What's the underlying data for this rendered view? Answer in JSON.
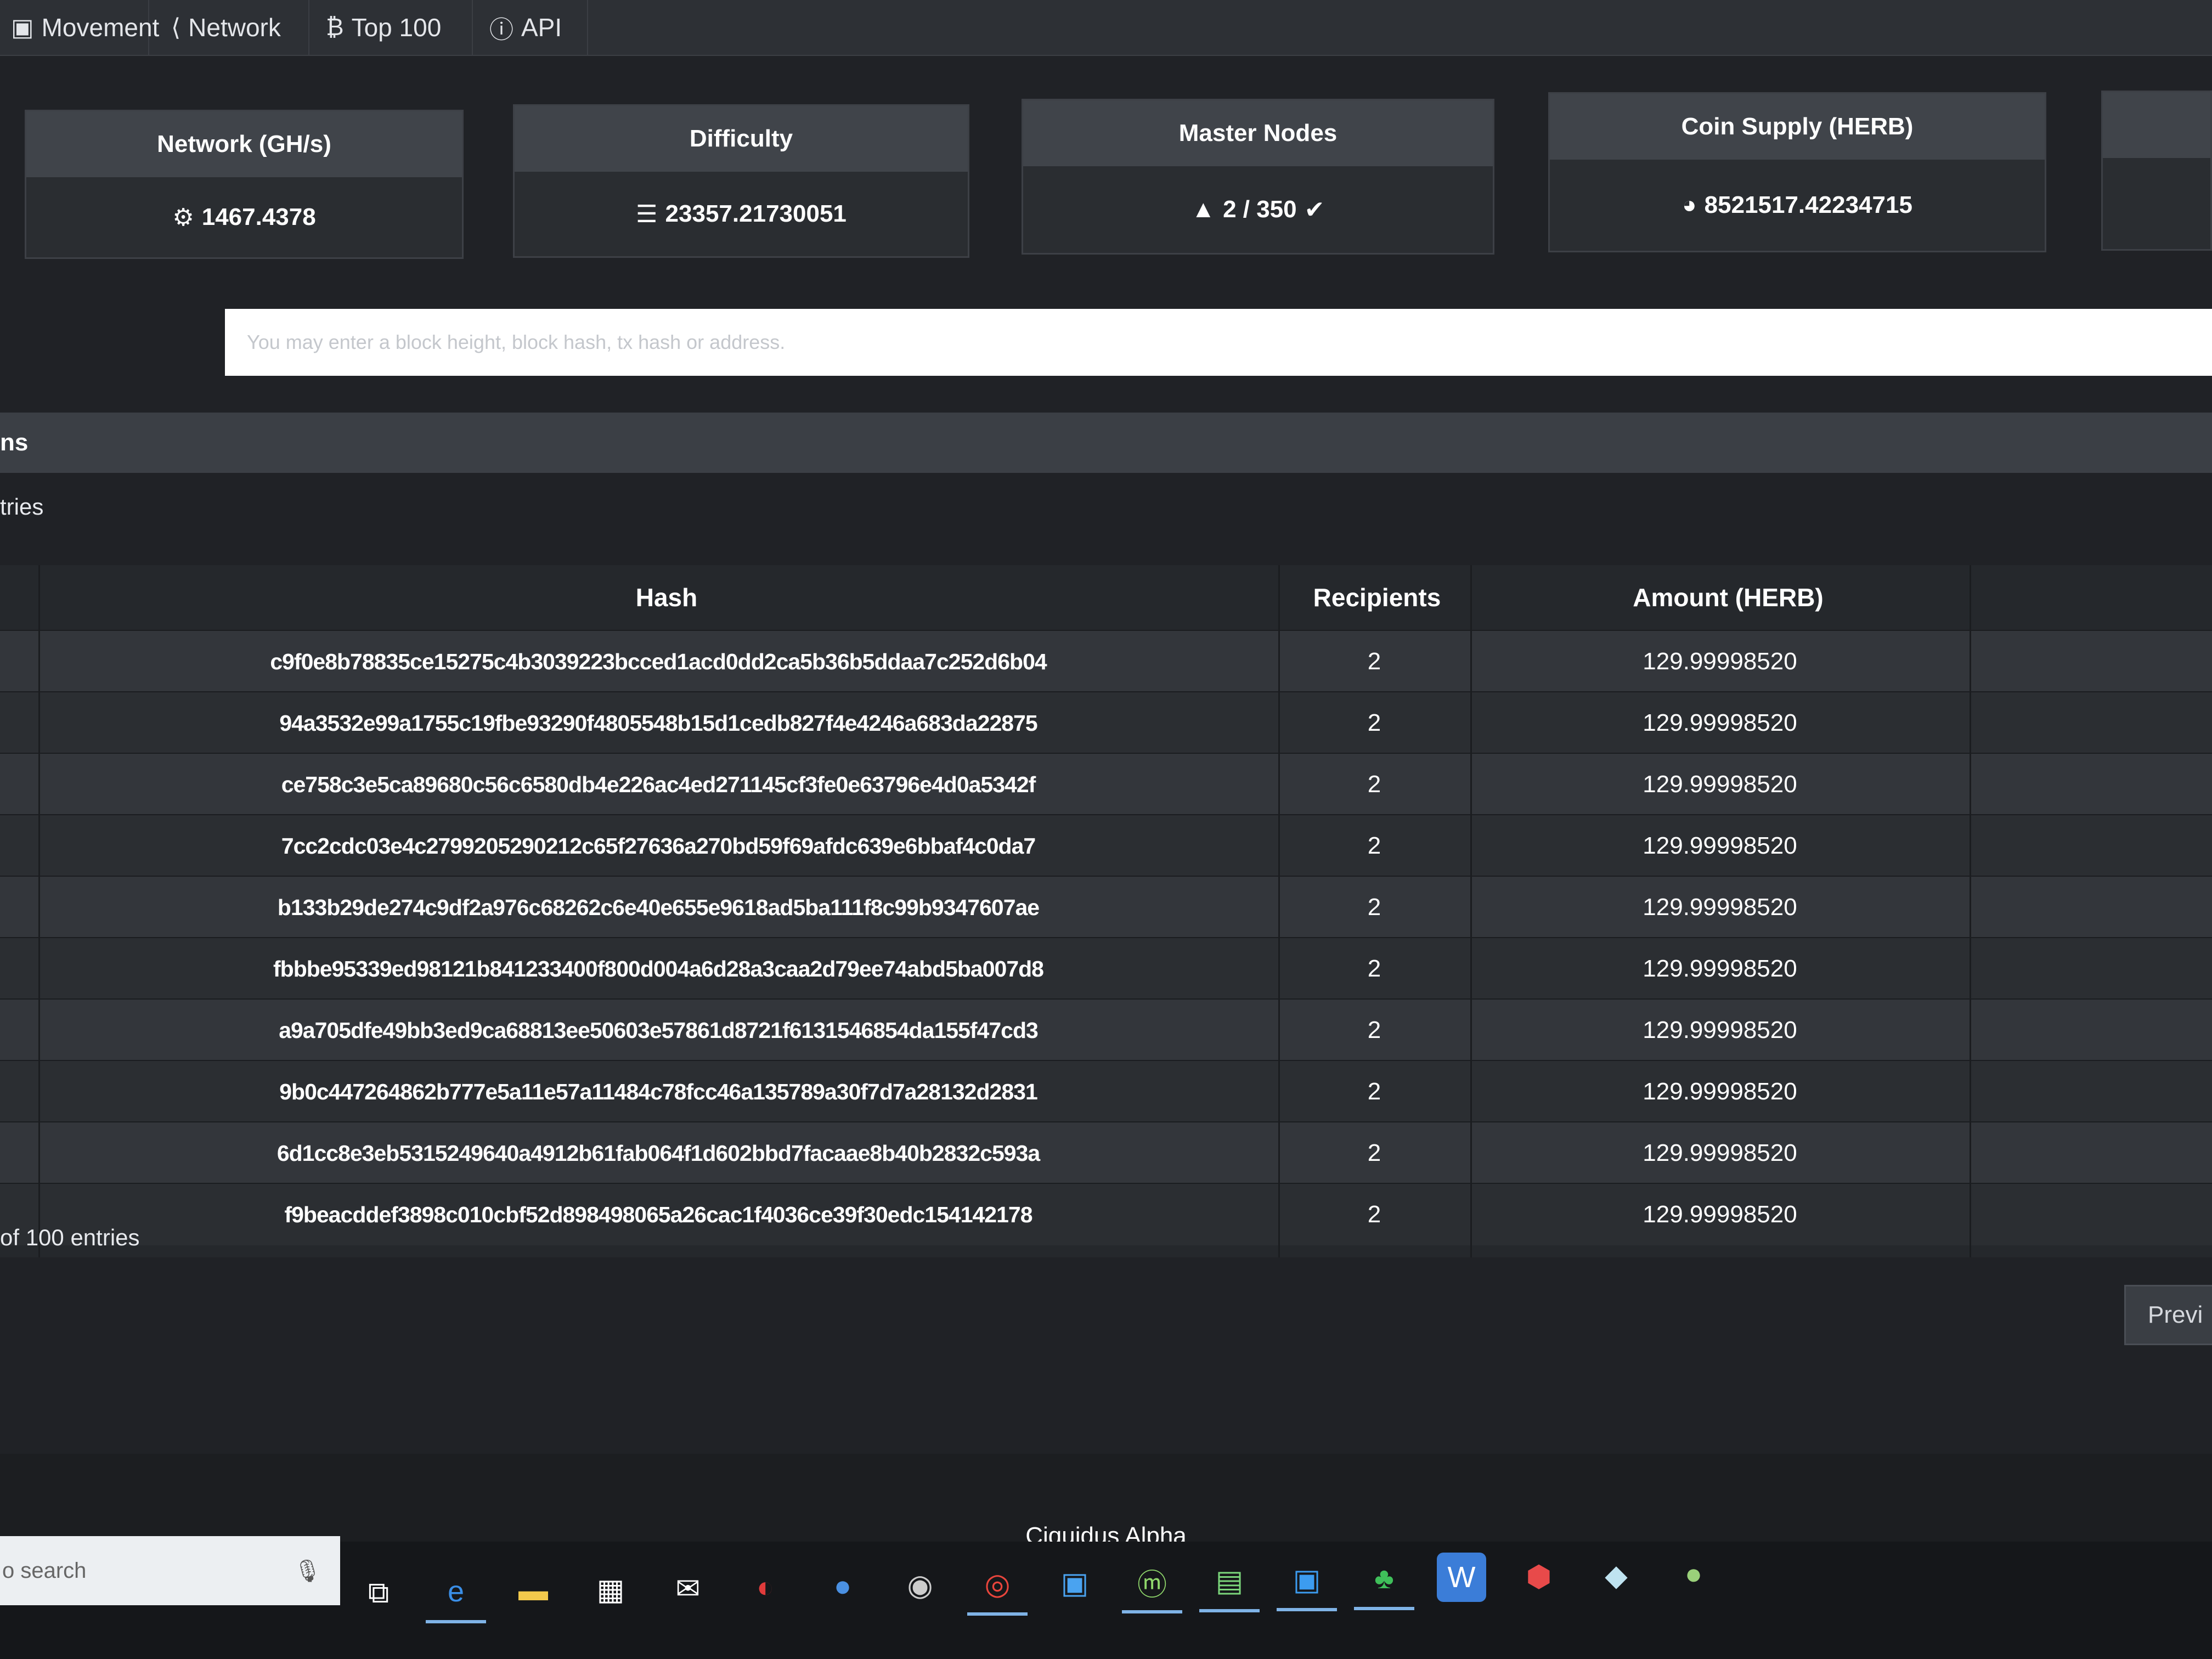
{
  "nav": {
    "items": [
      {
        "label": "Movement",
        "icon": "movement-icon",
        "glyph": "▣"
      },
      {
        "label": "Network",
        "icon": "network-icon",
        "glyph": "⟨"
      },
      {
        "label": "Top 100",
        "icon": "bitcoin-icon",
        "glyph": "₿"
      },
      {
        "label": "API",
        "icon": "info-icon",
        "glyph": "ⓘ"
      }
    ]
  },
  "stats": [
    {
      "title": "Network (GH/s)",
      "value": "1467.4378",
      "icon": "cogs-icon",
      "glyph": "⚙"
    },
    {
      "title": "Difficulty",
      "value": "23357.21730051",
      "icon": "sliders-icon",
      "glyph": "☰"
    },
    {
      "title": "Master Nodes",
      "value": "2 / 350",
      "icon": "warning-icon",
      "glyph": "▲",
      "suffix_icon": "check-circle-icon",
      "suffix_glyph": "✔"
    },
    {
      "title": "Coin Supply (HERB)",
      "value": "8521517.42234715",
      "icon": "pie-chart-icon",
      "glyph": "◕"
    }
  ],
  "search": {
    "placeholder": "You may enter a block height, block hash, tx hash or address."
  },
  "panel": {
    "title": "ns",
    "entries_label": "tries",
    "showing": "of 100 entries",
    "prev_label": "Previ"
  },
  "table": {
    "columns": {
      "hash": "Hash",
      "recipients": "Recipients",
      "amount": "Amount (HERB)"
    },
    "rows": [
      {
        "hash": "c9f0e8b78835ce15275c4b3039223bcced1acd0dd2ca5b36b5ddaa7c252d6b04",
        "recipients": "2",
        "amount": "129.99998520"
      },
      {
        "hash": "94a3532e99a1755c19fbe93290f4805548b15d1cedb827f4e4246a683da22875",
        "recipients": "2",
        "amount": "129.99998520"
      },
      {
        "hash": "ce758c3e5ca89680c56c6580db4e226ac4ed271145cf3fe0e63796e4d0a5342f",
        "recipients": "2",
        "amount": "129.99998520"
      },
      {
        "hash": "7cc2cdc03e4c2799205290212c65f27636a270bd59f69afdc639e6bbaf4c0da7",
        "recipients": "2",
        "amount": "129.99998520"
      },
      {
        "hash": "b133b29de274c9df2a976c68262c6e40e655e9618ad5ba111f8c99b9347607ae",
        "recipients": "2",
        "amount": "129.99998520"
      },
      {
        "hash": "fbbbe95339ed98121b841233400f800d004a6d28a3caa2d79ee74abd5ba007d8",
        "recipients": "2",
        "amount": "129.99998520"
      },
      {
        "hash": "a9a705dfe49bb3ed9ca68813ee50603e57861d8721f6131546854da155f47cd3",
        "recipients": "2",
        "amount": "129.99998520"
      },
      {
        "hash": "9b0c447264862b777e5a11e57a11484c78fcc46a135789a30f7d7a28132d2831",
        "recipients": "2",
        "amount": "129.99998520"
      },
      {
        "hash": "6d1cc8e3eb5315249640a4912b61fab064f1d602bbd7facaae8b40b2832c593a",
        "recipients": "2",
        "amount": "129.99998520"
      },
      {
        "hash": "f9beacddef3898c010cbf52d898498065a26cac1f4036ce39f30edc154142178",
        "recipients": "2",
        "amount": "129.99998520"
      }
    ]
  },
  "footer": {
    "label": "Ciquidus Alpha"
  },
  "taskbar": {
    "search_text": "o search",
    "icons": [
      {
        "name": "task-view-icon",
        "glyph": "⧉",
        "color": "#ffffff",
        "bg": "transparent"
      },
      {
        "name": "edge-icon",
        "glyph": "e",
        "color": "#3a8ee6",
        "bg": "transparent"
      },
      {
        "name": "file-explorer-icon",
        "glyph": "▬",
        "color": "#f2c94c",
        "bg": "transparent"
      },
      {
        "name": "store-icon",
        "glyph": "▦",
        "color": "#ffffff",
        "bg": "transparent"
      },
      {
        "name": "mail-icon",
        "glyph": "✉",
        "color": "#ffffff",
        "bg": "transparent"
      },
      {
        "name": "app-red-icon",
        "glyph": "◐",
        "color": "#e03b3b",
        "bg": "transparent"
      },
      {
        "name": "app-blue-icon",
        "glyph": "●",
        "color": "#4a90e2",
        "bg": "transparent"
      },
      {
        "name": "app-gray-icon",
        "glyph": "◉",
        "color": "#cccccc",
        "bg": "transparent"
      },
      {
        "name": "chrome-icon",
        "glyph": "◎",
        "color": "#e8453c",
        "bg": "transparent"
      },
      {
        "name": "window-app-icon",
        "glyph": "▣",
        "color": "#4aa3f0",
        "bg": "transparent"
      },
      {
        "name": "mint-app-icon",
        "glyph": "ⓜ",
        "color": "#8fd66b",
        "bg": "transparent"
      },
      {
        "name": "green-window-icon",
        "glyph": "▤",
        "color": "#7bd67b",
        "bg": "transparent"
      },
      {
        "name": "blue-window-icon",
        "glyph": "▣",
        "color": "#3c9cf0",
        "bg": "transparent"
      },
      {
        "name": "tree-icon",
        "glyph": "♣",
        "color": "#3fbf5a",
        "bg": "transparent"
      },
      {
        "name": "w-app-icon",
        "glyph": "W",
        "color": "#ffffff",
        "bg": "#3b7dd8"
      },
      {
        "name": "cube-red-icon",
        "glyph": "⬢",
        "color": "#e84a4a",
        "bg": "transparent"
      },
      {
        "name": "cube-light-icon",
        "glyph": "◆",
        "color": "#bfe3f0",
        "bg": "transparent"
      },
      {
        "name": "green-ball-icon",
        "glyph": "●",
        "color": "#9ad07a",
        "bg": "transparent"
      }
    ]
  }
}
